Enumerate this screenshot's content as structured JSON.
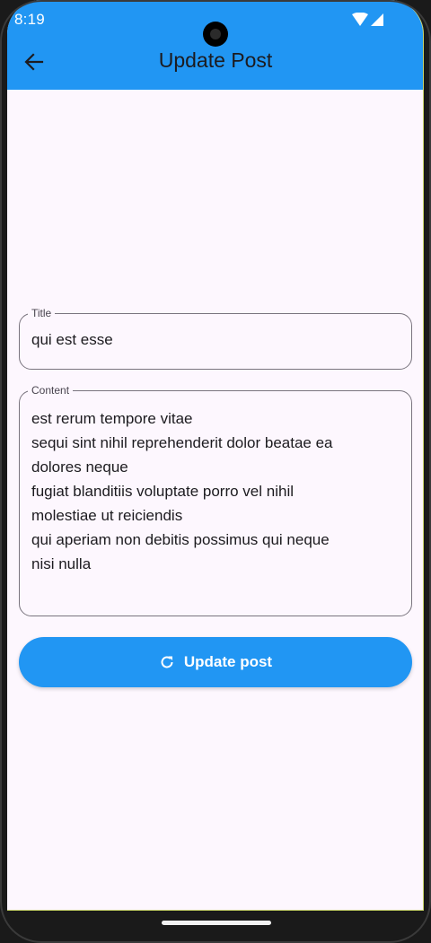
{
  "status_bar": {
    "time": "8:19",
    "icons": [
      "wifi-icon",
      "signal-icon"
    ]
  },
  "app_bar": {
    "title": "Update Post",
    "back_icon": "arrow-back-icon",
    "background": "#2196f3"
  },
  "form": {
    "title_field": {
      "label": "Title",
      "value": "qui est esse"
    },
    "content_field": {
      "label": "Content",
      "value": "est rerum tempore vitae\nsequi sint nihil reprehenderit dolor beatae ea\ndolores neque\nfugiat blanditiis voluptate porro vel nihil\nmolestiae ut reiciendis\nqui aperiam non debitis possimus qui neque\nnisi nulla"
    },
    "submit_button": {
      "label": "Update post",
      "icon": "refresh-icon",
      "background": "#2196f3"
    }
  }
}
